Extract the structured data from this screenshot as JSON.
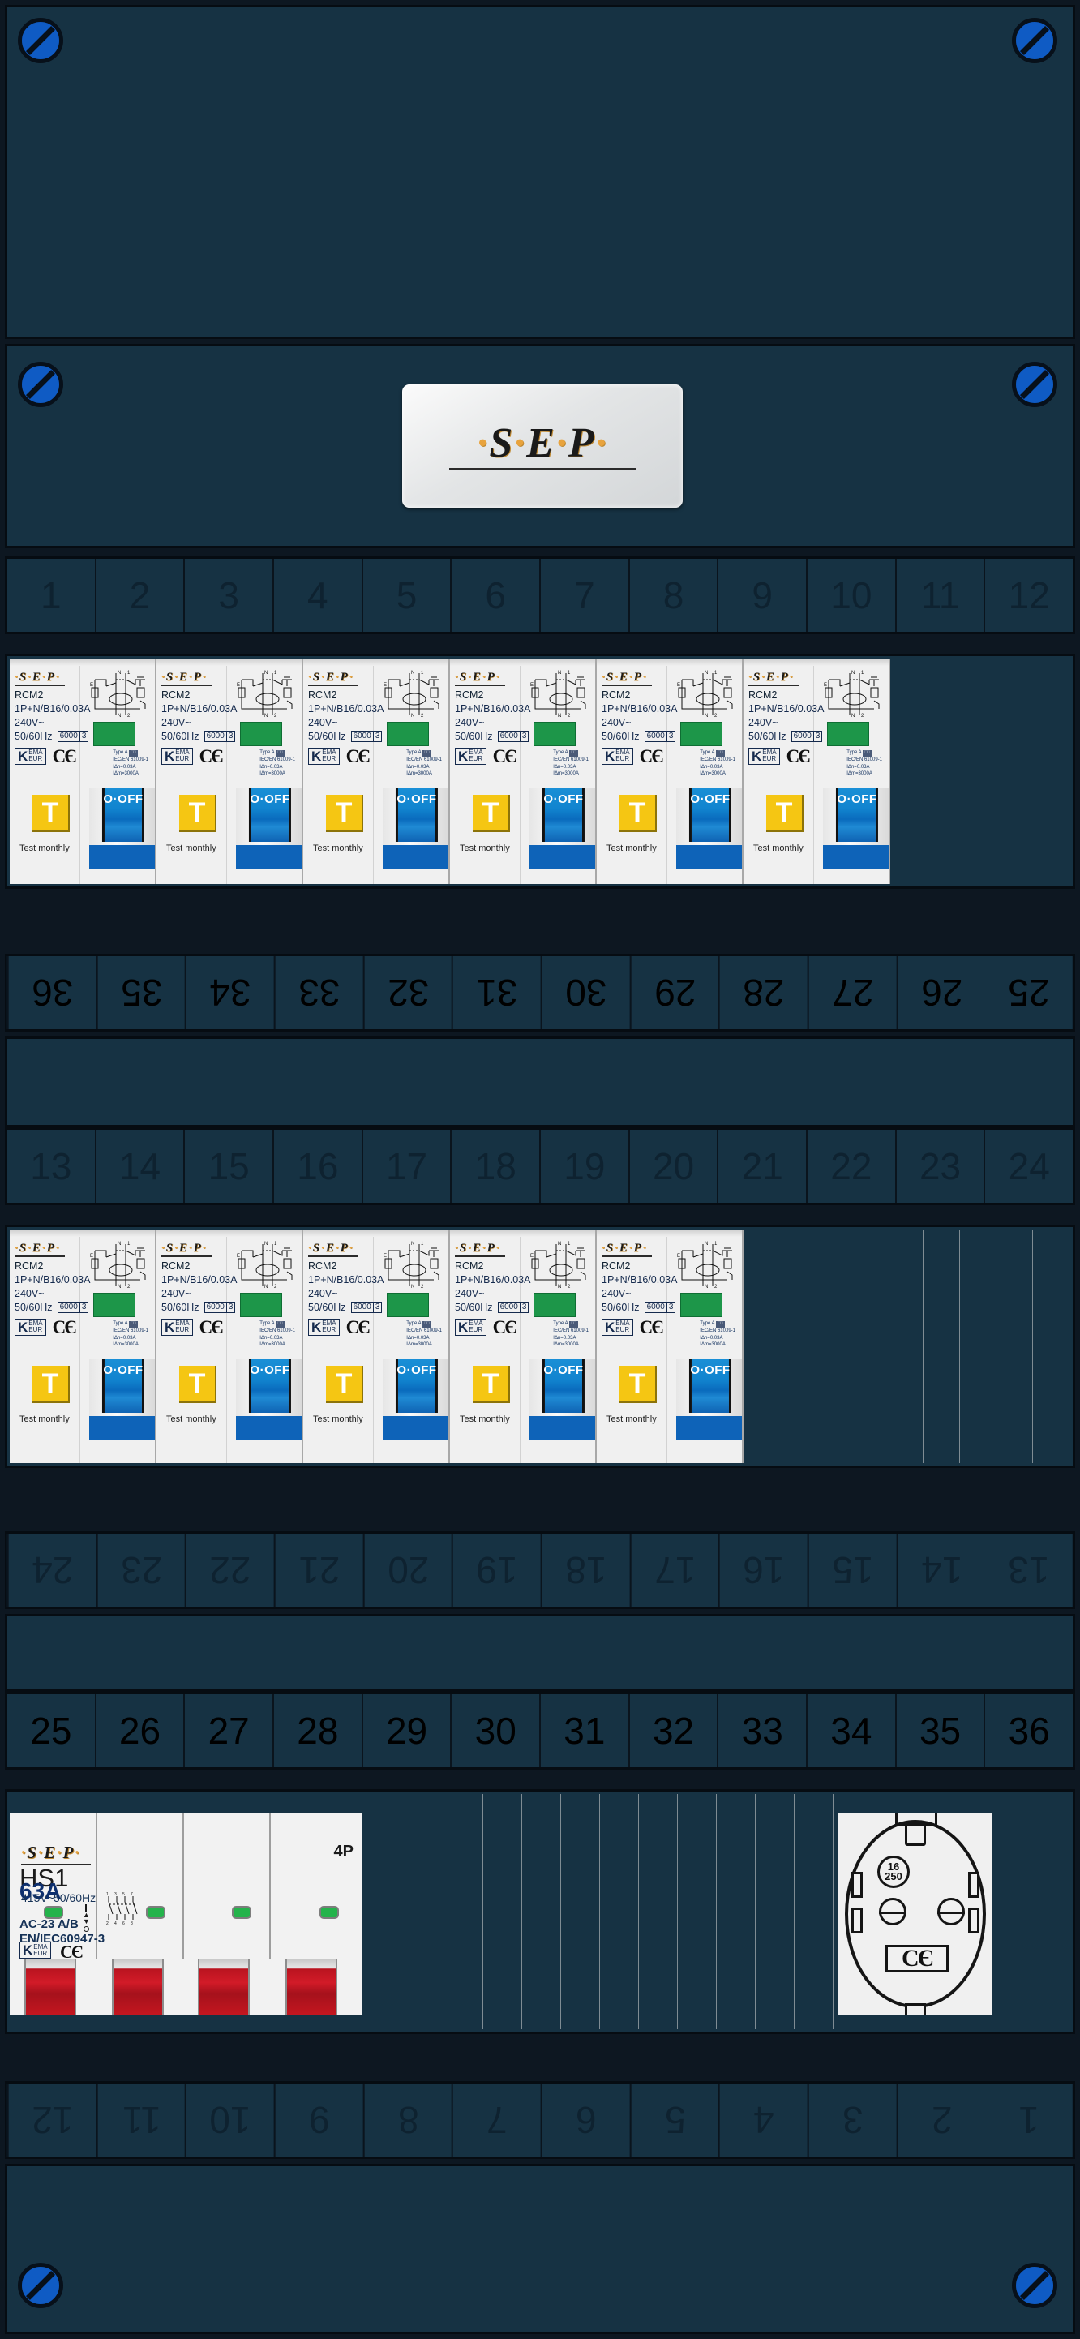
{
  "board": {
    "brand": "SEP",
    "body_color": "#163243",
    "frame_color": "#060c12",
    "screw_color": "#0f5bc4"
  },
  "brand_plate": {
    "letters": [
      "S",
      "E",
      "P"
    ],
    "dot": "·"
  },
  "number_rows": {
    "row_top": [
      "1",
      "2",
      "3",
      "4",
      "5",
      "6",
      "7",
      "8",
      "9",
      "10",
      "11",
      "12"
    ],
    "row_flip_36_25": [
      "36",
      "35",
      "34",
      "33",
      "32",
      "31",
      "30",
      "29",
      "28",
      "27",
      "26",
      "25"
    ],
    "row_13_24": [
      "13",
      "14",
      "15",
      "16",
      "17",
      "18",
      "19",
      "20",
      "21",
      "22",
      "23",
      "24"
    ],
    "row_flip_24_13": [
      "24",
      "23",
      "22",
      "21",
      "20",
      "19",
      "18",
      "17",
      "16",
      "15",
      "14",
      "13"
    ],
    "row_25_36": [
      "25",
      "26",
      "27",
      "28",
      "29",
      "30",
      "31",
      "32",
      "33",
      "34",
      "35",
      "36"
    ],
    "row_flip_12_1": [
      "12",
      "11",
      "10",
      "9",
      "8",
      "7",
      "6",
      "5",
      "4",
      "3",
      "2",
      "1"
    ]
  },
  "rcbo": {
    "brand": "SEP",
    "model": "RCM2",
    "rating": "1P+N/B16/0.03A",
    "voltage": "240V~",
    "frequency": "50/60Hz",
    "breaking_capacity": "6000",
    "energy_class": "3",
    "approval_k": "K",
    "approval_line1": "EMA",
    "approval_line2": "EUR",
    "ce_mark": "CE",
    "rcd_type": "Type A",
    "rcd_standard": "IEC/EN 61009-1",
    "rcd_sensitivity": "IΔn=0.03A",
    "rcd_breaking": "IΔm=3000A",
    "test_button_letter": "T",
    "test_label": "Test  monthly",
    "switch_label": "O·OFF",
    "indicator_color": "#1d9649",
    "schematic_terminals_top": [
      "N",
      "1"
    ],
    "schematic_terminals_bottom": [
      "N",
      "2"
    ],
    "count_row1": 6,
    "count_row2": 5
  },
  "main_switch": {
    "brand": "SEP",
    "model": "HS1",
    "current": "63A",
    "voltage": "415V~",
    "frequency": "50/60Hz",
    "utilisation": "AC-23 A/B",
    "standard": "EN/IEC60947-3",
    "approval_k": "K",
    "approval_line1": "EMA",
    "approval_line2": "EUR",
    "ce_mark": "CE",
    "poles": "4P",
    "schematic_terminals_top": [
      "1",
      "3",
      "5",
      "7"
    ],
    "schematic_terminals_bottom": [
      "2",
      "4",
      "6",
      "8"
    ],
    "indicator_color": "#24b34b",
    "toggle_color": "#c4161f"
  },
  "socket": {
    "type": "schuko-outlet",
    "rating_current": "16",
    "rating_voltage": "250",
    "ce_mark": "CE"
  }
}
